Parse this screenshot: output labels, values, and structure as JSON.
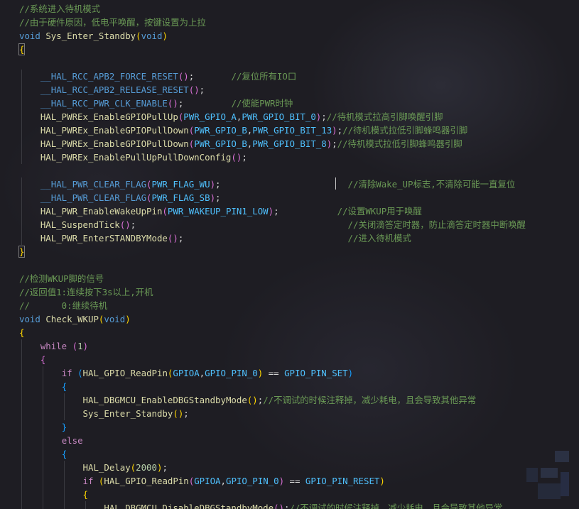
{
  "editor": {
    "lines": [
      [
        [
          "cmt",
          "//系统进入待机模式"
        ]
      ],
      [
        [
          "cmt",
          "//由于硬件原因，低电平唤醒，按键设置为上拉"
        ]
      ],
      [
        [
          "kw",
          "void"
        ],
        [
          "pun",
          " "
        ],
        [
          "fn",
          "Sys_Enter_Standby"
        ],
        [
          "br1",
          "("
        ],
        [
          "kw",
          "void"
        ],
        [
          "br1",
          ")"
        ]
      ],
      [
        [
          "br1m",
          "{"
        ]
      ],
      [],
      [
        [
          "pun",
          "    "
        ],
        [
          "mac",
          "__HAL_RCC_APB2_FORCE_RESET"
        ],
        [
          "br2",
          "("
        ],
        [
          "br2",
          ")"
        ],
        [
          "pun",
          ";       "
        ],
        [
          "cmt",
          "//复位所有IO口"
        ]
      ],
      [
        [
          "pun",
          "    "
        ],
        [
          "mac",
          "__HAL_RCC_APB2_RELEASE_RESET"
        ],
        [
          "br2",
          "("
        ],
        [
          "br2",
          ")"
        ],
        [
          "pun",
          ";"
        ]
      ],
      [
        [
          "pun",
          "    "
        ],
        [
          "mac",
          "__HAL_RCC_PWR_CLK_ENABLE"
        ],
        [
          "br2",
          "("
        ],
        [
          "br2",
          ")"
        ],
        [
          "pun",
          ";         "
        ],
        [
          "cmt",
          "//使能PWR时钟"
        ]
      ],
      [
        [
          "pun",
          "    "
        ],
        [
          "fn",
          "HAL_PWREx_EnableGPIOPullUp"
        ],
        [
          "br2",
          "("
        ],
        [
          "con",
          "PWR_GPIO_A"
        ],
        [
          "pun",
          ","
        ],
        [
          "con",
          "PWR_GPIO_BIT_0"
        ],
        [
          "br2",
          ")"
        ],
        [
          "pun",
          ";"
        ],
        [
          "cmt",
          "//待机模式拉高引脚唤醒引脚"
        ]
      ],
      [
        [
          "pun",
          "    "
        ],
        [
          "fn",
          "HAL_PWREx_EnableGPIOPullDown"
        ],
        [
          "br2",
          "("
        ],
        [
          "con",
          "PWR_GPIO_B"
        ],
        [
          "pun",
          ","
        ],
        [
          "con",
          "PWR_GPIO_BIT_13"
        ],
        [
          "br2",
          ")"
        ],
        [
          "pun",
          ";"
        ],
        [
          "cmt",
          "//待机模式拉低引脚蜂鸣器引脚"
        ]
      ],
      [
        [
          "pun",
          "    "
        ],
        [
          "fn",
          "HAL_PWREx_EnableGPIOPullDown"
        ],
        [
          "br2",
          "("
        ],
        [
          "con",
          "PWR_GPIO_B"
        ],
        [
          "pun",
          ","
        ],
        [
          "con",
          "PWR_GPIO_BIT_8"
        ],
        [
          "br2",
          ")"
        ],
        [
          "pun",
          ";"
        ],
        [
          "cmt",
          "//待机模式拉低引脚蜂鸣器引脚"
        ]
      ],
      [
        [
          "pun",
          "    "
        ],
        [
          "fn",
          "HAL_PWREx_EnablePullUpPullDownConfig"
        ],
        [
          "br2",
          "("
        ],
        [
          "br2",
          ")"
        ],
        [
          "pun",
          ";"
        ]
      ],
      [],
      [
        [
          "pun",
          "    "
        ],
        [
          "mac",
          "__HAL_PWR_CLEAR_FLAG"
        ],
        [
          "br2",
          "("
        ],
        [
          "con",
          "PWR_FLAG_WU"
        ],
        [
          "br2",
          ")"
        ],
        [
          "pun",
          ";                        "
        ],
        [
          "cmt",
          "//清除Wake_UP标志,不清除可能一直复位"
        ]
      ],
      [
        [
          "pun",
          "    "
        ],
        [
          "mac",
          "__HAL_PWR_CLEAR_FLAG"
        ],
        [
          "br2",
          "("
        ],
        [
          "con",
          "PWR_FLAG_SB"
        ],
        [
          "br2",
          ")"
        ],
        [
          "pun",
          ";"
        ]
      ],
      [
        [
          "pun",
          "    "
        ],
        [
          "fn",
          "HAL_PWR_EnableWakeUpPin"
        ],
        [
          "br2",
          "("
        ],
        [
          "con",
          "PWR_WAKEUP_PIN1_LOW"
        ],
        [
          "br2",
          ")"
        ],
        [
          "pun",
          ";           "
        ],
        [
          "cmt",
          "//设置WKUP用于唤醒"
        ]
      ],
      [
        [
          "pun",
          "    "
        ],
        [
          "fn",
          "HAL_SuspendTick"
        ],
        [
          "br2",
          "("
        ],
        [
          "br2",
          ")"
        ],
        [
          "pun",
          ";                                        "
        ],
        [
          "cmt",
          "//关闭滴答定时器，防止滴答定时器中断唤醒"
        ]
      ],
      [
        [
          "pun",
          "    "
        ],
        [
          "fn",
          "HAL_PWR_EnterSTANDBYMode"
        ],
        [
          "br2",
          "("
        ],
        [
          "br2",
          ")"
        ],
        [
          "pun",
          ";                               "
        ],
        [
          "cmt",
          "//进入待机模式"
        ]
      ],
      [
        [
          "br1m",
          "}"
        ]
      ],
      [],
      [
        [
          "cmt",
          "//检测WKUP脚的信号"
        ]
      ],
      [
        [
          "cmt",
          "//返回值1:连续按下3s以上,开机"
        ]
      ],
      [
        [
          "cmt",
          "//      0:继续待机"
        ]
      ],
      [
        [
          "kw",
          "void"
        ],
        [
          "pun",
          " "
        ],
        [
          "fn",
          "Check_WKUP"
        ],
        [
          "br1",
          "("
        ],
        [
          "kw",
          "void"
        ],
        [
          "br1",
          ")"
        ]
      ],
      [
        [
          "br1",
          "{"
        ]
      ],
      [
        [
          "pun",
          "    "
        ],
        [
          "ctl",
          "while"
        ],
        [
          "pun",
          " "
        ],
        [
          "br2",
          "("
        ],
        [
          "num",
          "1"
        ],
        [
          "br2",
          ")"
        ]
      ],
      [
        [
          "pun",
          "    "
        ],
        [
          "br2",
          "{"
        ]
      ],
      [
        [
          "pun",
          "        "
        ],
        [
          "ctl",
          "if"
        ],
        [
          "pun",
          " "
        ],
        [
          "br3",
          "("
        ],
        [
          "fn",
          "HAL_GPIO_ReadPin"
        ],
        [
          "br1",
          "("
        ],
        [
          "con",
          "GPIOA"
        ],
        [
          "pun",
          ","
        ],
        [
          "con",
          "GPIO_PIN_0"
        ],
        [
          "br1",
          ")"
        ],
        [
          "pun",
          " == "
        ],
        [
          "con",
          "GPIO_PIN_SET"
        ],
        [
          "br3",
          ")"
        ]
      ],
      [
        [
          "pun",
          "        "
        ],
        [
          "br3",
          "{"
        ]
      ],
      [
        [
          "pun",
          "            "
        ],
        [
          "fn",
          "HAL_DBGMCU_EnableDBGStandbyMode"
        ],
        [
          "br1",
          "("
        ],
        [
          "br1",
          ")"
        ],
        [
          "pun",
          ";"
        ],
        [
          "cmt",
          "//不调试的时候注释掉，减少耗电，且会导致其他异常"
        ]
      ],
      [
        [
          "pun",
          "            "
        ],
        [
          "fn",
          "Sys_Enter_Standby"
        ],
        [
          "br1",
          "("
        ],
        [
          "br1",
          ")"
        ],
        [
          "pun",
          ";"
        ]
      ],
      [
        [
          "pun",
          "        "
        ],
        [
          "br3",
          "}"
        ]
      ],
      [
        [
          "pun",
          "        "
        ],
        [
          "ctl",
          "else"
        ]
      ],
      [
        [
          "pun",
          "        "
        ],
        [
          "br3",
          "{"
        ]
      ],
      [
        [
          "pun",
          "            "
        ],
        [
          "fn",
          "HAL_Delay"
        ],
        [
          "br1",
          "("
        ],
        [
          "num",
          "2000"
        ],
        [
          "br1",
          ")"
        ],
        [
          "pun",
          ";"
        ]
      ],
      [
        [
          "pun",
          "            "
        ],
        [
          "ctl",
          "if"
        ],
        [
          "pun",
          " "
        ],
        [
          "br1",
          "("
        ],
        [
          "fn",
          "HAL_GPIO_ReadPin"
        ],
        [
          "br2",
          "("
        ],
        [
          "con",
          "GPIOA"
        ],
        [
          "pun",
          ","
        ],
        [
          "con",
          "GPIO_PIN_0"
        ],
        [
          "br2",
          ")"
        ],
        [
          "pun",
          " == "
        ],
        [
          "con",
          "GPIO_PIN_RESET"
        ],
        [
          "br1",
          ")"
        ]
      ],
      [
        [
          "pun",
          "            "
        ],
        [
          "br1",
          "{"
        ]
      ],
      [
        [
          "pun",
          "                "
        ],
        [
          "fn",
          "HAL_DBGMCU_DisableDBGStandbyMode"
        ],
        [
          "br2",
          "("
        ],
        [
          "br2",
          ")"
        ],
        [
          "pun",
          ";"
        ],
        [
          "cmt",
          "//不调试的时候注释掉，减少耗电，且会导致其他异常"
        ]
      ]
    ]
  },
  "colors": {
    "comment": "#6a9955",
    "keyword": "#569cd6",
    "control": "#c586c0",
    "function": "#dcdcaa",
    "constant": "#4fc1ff",
    "number": "#b5cea8",
    "bracket_1": "#ffd700",
    "bracket_2": "#da70d6",
    "bracket_3": "#179fff"
  },
  "icons": {
    "watermark": "watermark-logo-icon",
    "cursor": "text-cursor"
  }
}
